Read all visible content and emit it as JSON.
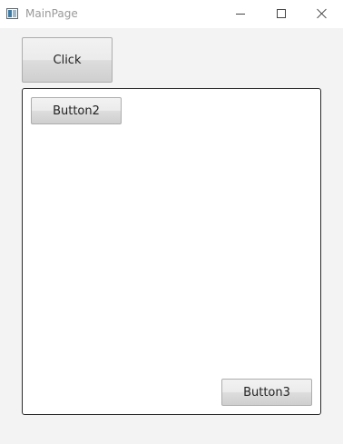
{
  "window": {
    "title": "MainPage",
    "icon": "app-window-icon"
  },
  "caption_buttons": {
    "minimize_icon": "minimize-icon",
    "maximize_icon": "maximize-icon",
    "close_icon": "close-icon"
  },
  "main": {
    "click_button_label": "Click",
    "panel": {
      "button2_label": "Button2",
      "button3_label": "Button3"
    }
  }
}
